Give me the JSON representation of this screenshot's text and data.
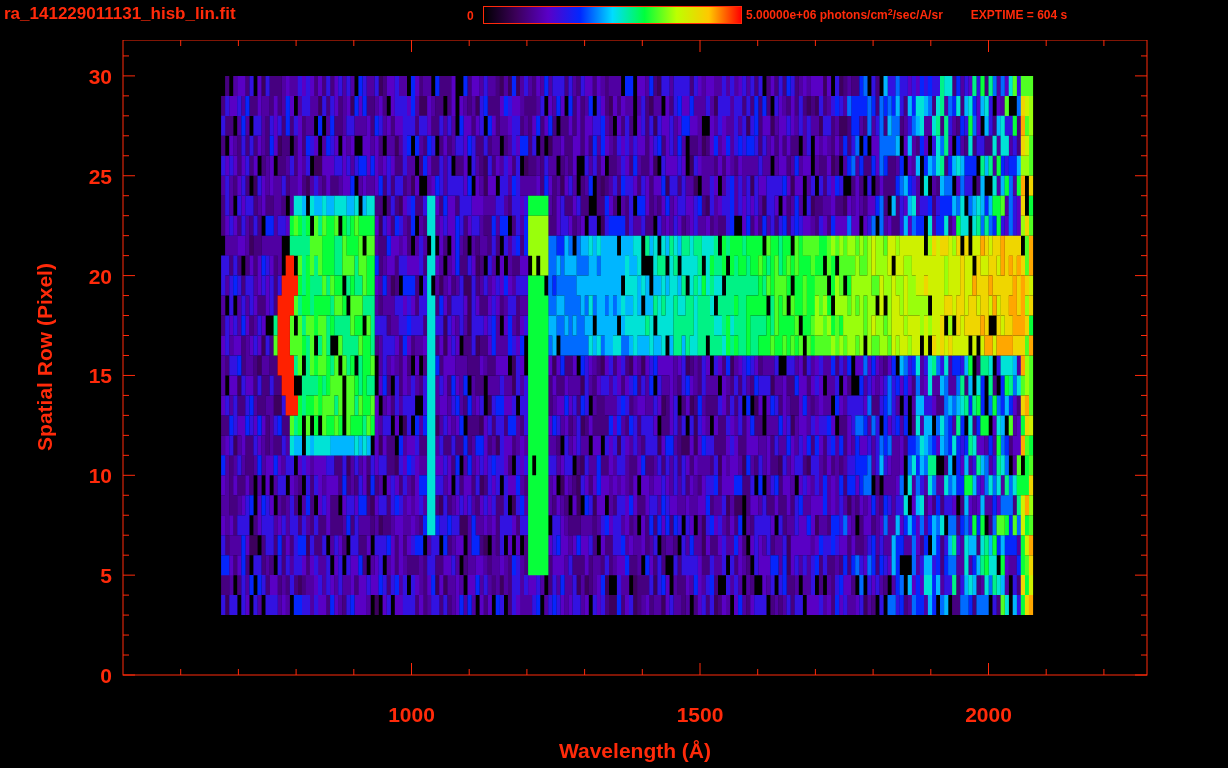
{
  "plot": {
    "title": "ra_141229011131_hisb_lin.fit",
    "colorbar": {
      "min_label": "0",
      "max_label": "5.00000e+06 photons/cm$^{2}$/sec/A/sr"
    },
    "exposure": "EXPTIME = 604 s",
    "xlabel": "Wavelength (Å)",
    "ylabel": "Spatial Row (Pixel)",
    "xticks": [
      "1000",
      "1500",
      "2000"
    ],
    "yticks": [
      "30",
      "25",
      "20",
      "15",
      "10",
      "5",
      "0"
    ]
  }
}
